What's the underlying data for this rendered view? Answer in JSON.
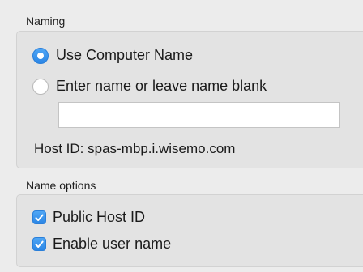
{
  "naming": {
    "title": "Naming",
    "use_computer_name": {
      "label": "Use Computer Name",
      "selected": true
    },
    "enter_name": {
      "label": "Enter name or leave name blank",
      "selected": false
    },
    "name_field": {
      "value": "",
      "placeholder": ""
    },
    "host_id_label": "Host ID:",
    "host_id_value": "spas-mbp.i.wisemo.com"
  },
  "name_options": {
    "title": "Name options",
    "public_host_id": {
      "label": "Public Host ID",
      "checked": true
    },
    "enable_user_name": {
      "label": "Enable user name",
      "checked": true
    }
  },
  "colors": {
    "accent": "#2b86e6",
    "background": "#ececec",
    "group_background": "#e3e3e3"
  }
}
